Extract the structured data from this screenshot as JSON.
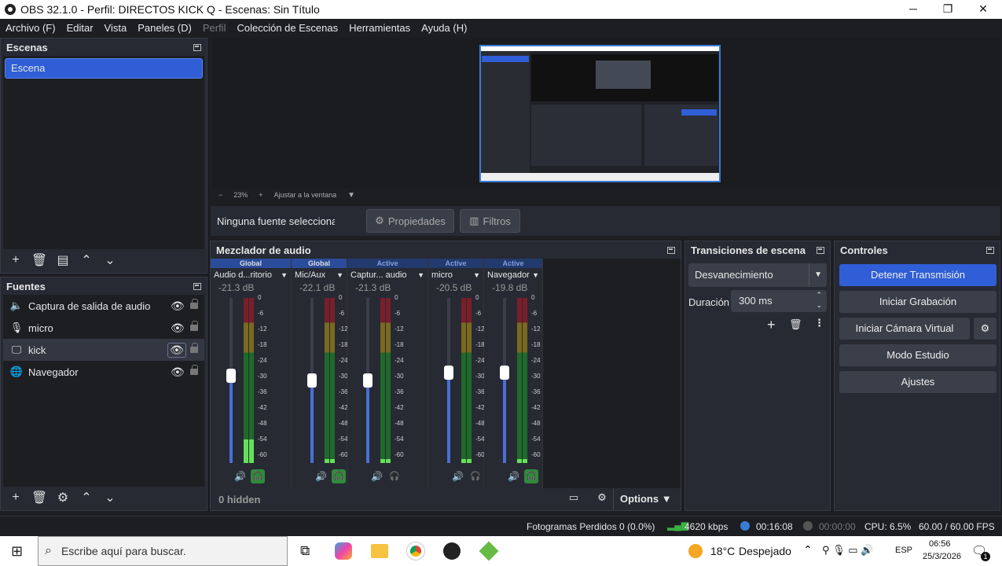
{
  "window": {
    "title": "OBS 32.1.0 - Perfil: DIRECTOS KICK Q - Escenas: Sin Título"
  },
  "menu": [
    "Archivo (F)",
    "Editar",
    "Vista",
    "Paneles (D)",
    "Perfil",
    "Colección de Escenas",
    "Herramientas",
    "Ayuda (H)"
  ],
  "scenes": {
    "title": "Escenas",
    "items": [
      "Escena"
    ]
  },
  "sources": {
    "title": "Fuentes",
    "items": [
      {
        "label": "Captura de salida de audio",
        "icon": "speaker-icon"
      },
      {
        "label": "micro",
        "icon": "microphone-icon"
      },
      {
        "label": "kick",
        "icon": "monitor-icon"
      },
      {
        "label": "Navegador",
        "icon": "globe-icon"
      }
    ]
  },
  "preview": {
    "zoom": "23%",
    "fit": "Ajustar a la ventana"
  },
  "source_bar": {
    "none_selected": "Ninguna fuente seleccionac",
    "properties": "Propiedades",
    "filters": "Filtros"
  },
  "mixer": {
    "title": "Mezclador de audio",
    "hidden": "0 hidden",
    "options": "Options",
    "ticks": [
      "0",
      "-6",
      "-12",
      "-18",
      "-24",
      "-30",
      "-36",
      "-42",
      "-48",
      "-54",
      "-60"
    ],
    "channels": [
      {
        "tag": "Global",
        "name": "Audio d...ritorio",
        "db": "-21.3 dB",
        "level": 0.38,
        "fader": 0.53
      },
      {
        "tag": "Global",
        "name": "Mic/Aux",
        "db": "-22.1 dB",
        "level": 0.67,
        "fader": 0.5
      },
      {
        "tag": "Active",
        "name": "Captur... audio",
        "db": "-21.3 dB",
        "level": 0.67,
        "fader": 0.5
      },
      {
        "tag": "Active",
        "name": "micro",
        "db": "-20.5 dB",
        "level": 0.67,
        "fader": 0.55
      },
      {
        "tag": "Active",
        "name": "Navegador",
        "db": "-19.8 dB",
        "level": 0.67,
        "fader": 0.55
      }
    ]
  },
  "transitions": {
    "title": "Transiciones de escena",
    "selected": "Desvanecimiento",
    "duration_label": "Duración",
    "duration": "300 ms"
  },
  "controls": {
    "title": "Controles",
    "buttons": [
      "Detener Transmisión",
      "Iniciar Grabación",
      "Iniciar Cámara Virtual",
      "Modo Estudio",
      "Ajustes"
    ]
  },
  "status": {
    "dropped": "Fotogramas Perdidos 0 (0.0%)",
    "bitrate": "4620 kbps",
    "stream_time": "00:16:08",
    "rec_time": "00:00:00",
    "cpu": "CPU: 6.5%",
    "fps": "60.00 / 60.00 FPS"
  },
  "taskbar": {
    "search": "Escribe aquí para buscar.",
    "temp": "18°C",
    "weather": "Despejado",
    "lang": "ESP",
    "time": "06:56",
    "date": "25/3/2026",
    "notif": "1"
  },
  "colors": {
    "accent": "#2f5ed6",
    "panel": "#272a33",
    "meter_green": "#3cb043"
  }
}
